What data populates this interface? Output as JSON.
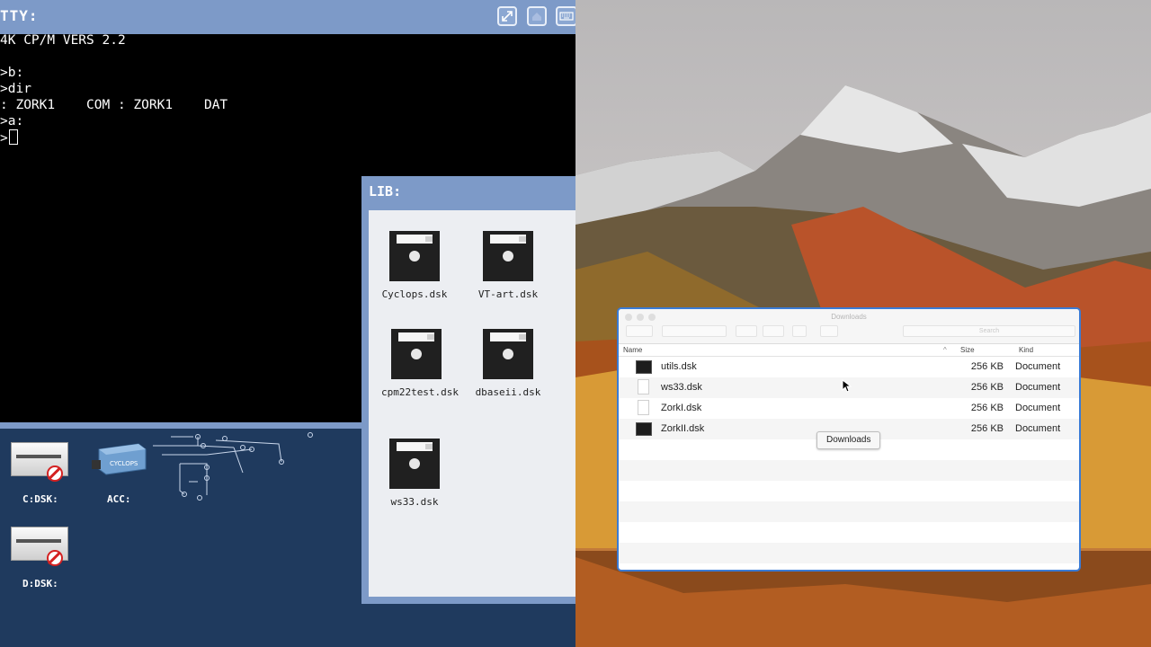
{
  "emulator": {
    "tty_title": "TTY:",
    "terminal_lines": [
      "4K CP/M VERS 2.2",
      "",
      ">b:",
      ">dir",
      ": ZORK1    COM : ZORK1    DAT",
      ">a:",
      ">"
    ],
    "toolbar": {
      "fullscreen_icon": "expand-icon",
      "home_icon": "home-icon",
      "keyboard_icon": "keyboard-icon"
    },
    "devices": [
      {
        "label": "C:DSK:",
        "icon": "disk-drive-icon",
        "status_icon": "no-entry-icon"
      },
      {
        "label": "ACC:",
        "icon": "cyclops-accelerator-icon"
      },
      {
        "label": "D:DSK:",
        "icon": "disk-drive-icon",
        "status_icon": "no-entry-icon"
      }
    ],
    "accelerator_text": "CYCLOPS"
  },
  "library": {
    "title": "LIB:",
    "disks": [
      {
        "name": "Cyclops.dsk"
      },
      {
        "name": "VT-art.dsk"
      },
      {
        "name": "cpm22test.dsk"
      },
      {
        "name": "dbaseii.dsk"
      },
      {
        "name": "ws33.dsk"
      }
    ]
  },
  "finder": {
    "title": "Downloads",
    "search_placeholder": "Search",
    "columns": {
      "name": "Name",
      "size": "Size",
      "kind": "Kind"
    },
    "files": [
      {
        "name": "utils.dsk",
        "size": "256 KB",
        "kind": "Document",
        "icon": "dark"
      },
      {
        "name": "ws33.dsk",
        "size": "256 KB",
        "kind": "Document",
        "icon": "doc"
      },
      {
        "name": "ZorkI.dsk",
        "size": "256 KB",
        "kind": "Document",
        "icon": "doc"
      },
      {
        "name": "ZorkII.dsk",
        "size": "256 KB",
        "kind": "Document",
        "icon": "dark"
      }
    ],
    "tooltip": "Downloads"
  },
  "colors": {
    "window_blue": "#7d9ac8",
    "device_panel": "#1f3a5e",
    "finder_focus": "#3a7bd5"
  }
}
